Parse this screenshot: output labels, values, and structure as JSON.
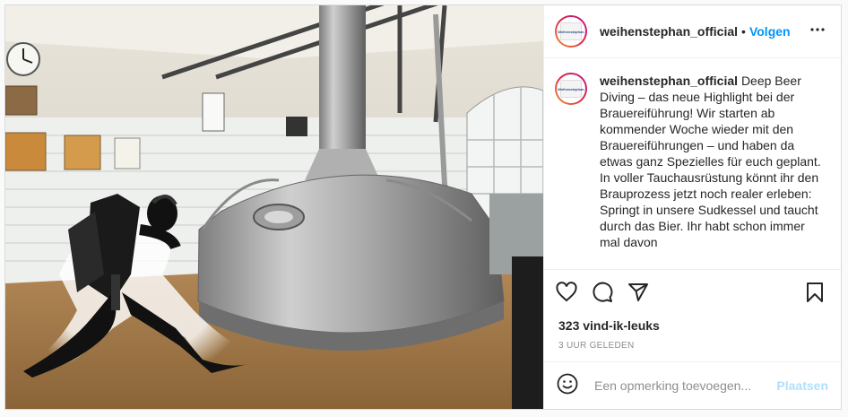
{
  "post": {
    "username": "weihenstephan_official",
    "separator": "•",
    "follow_label": "Volgen",
    "more_label": "•••",
    "logo_text": "Weihenstephan",
    "caption": "Deep Beer Diving – das neue Highlight bei der Brauereiführung! Wir starten ab kommender Woche wieder mit den Brauereiführungen – und haben da etwas ganz Spezielles für euch geplant. In voller Tauchausrüstung könnt ihr den Brauprozess jetzt noch realer erleben: Springt in unsere Sudkessel und taucht durch das Bier. Ihr habt schon immer mal davon",
    "likes": "323 vind-ik-leuks",
    "time": "3 UUR GELEDEN",
    "comment_placeholder": "Een opmerking toevoegen...",
    "post_label": "Plaatsen"
  },
  "icons": [
    "heart-icon",
    "comment-icon",
    "share-icon",
    "bookmark-icon",
    "emoji-icon",
    "more-icon"
  ]
}
